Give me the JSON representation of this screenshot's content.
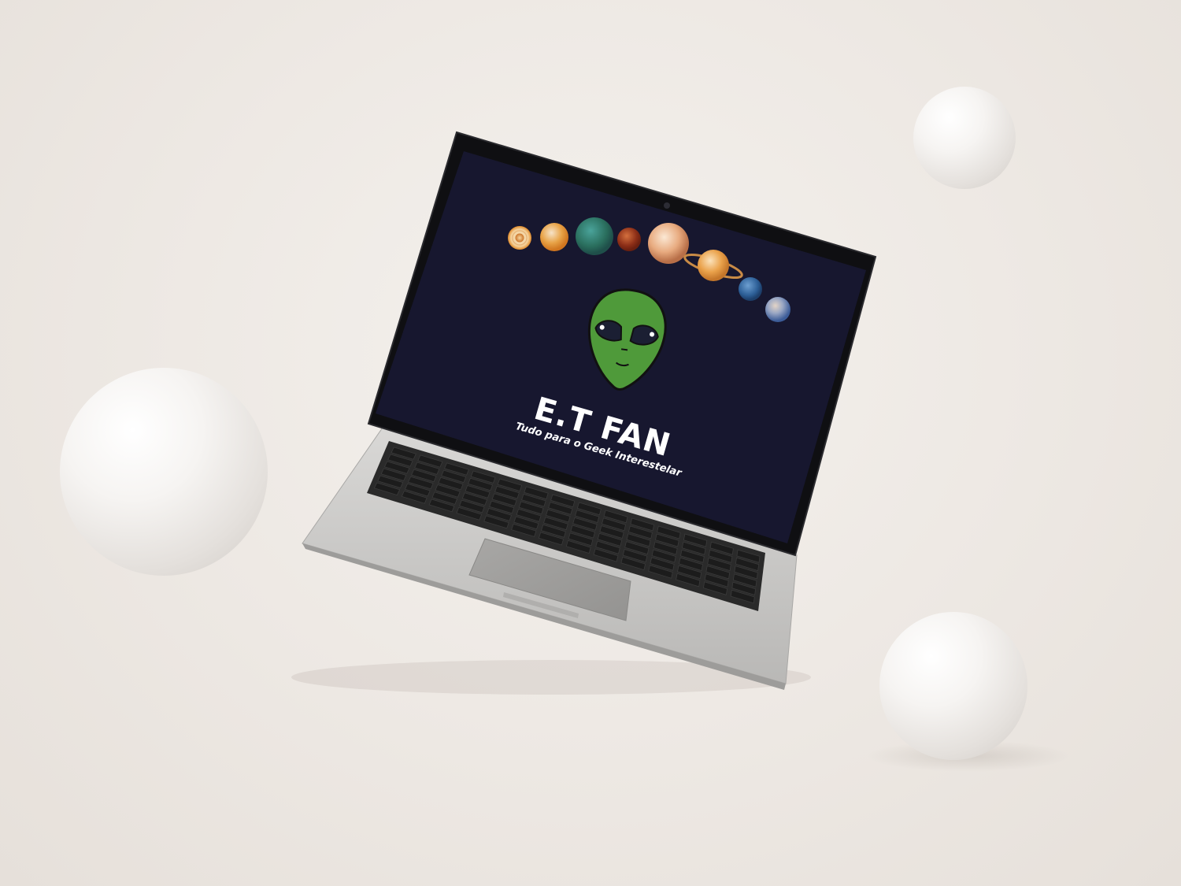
{
  "screen": {
    "brand_title": "E.T FAN",
    "tagline": "Tudo para o Geek Interestelar",
    "background_color": "#17172f",
    "alien_color": "#4f9a3a",
    "planets": [
      {
        "name": "sun-planet-icon",
        "color": "#e6892b"
      },
      {
        "name": "mercury-planet-icon",
        "color": "#e89a3a"
      },
      {
        "name": "earth-planet-icon",
        "color": "#2f7d6a"
      },
      {
        "name": "mars-planet-icon",
        "color": "#9e3a1f"
      },
      {
        "name": "jupiter-planet-icon",
        "color": "#e8b48a"
      },
      {
        "name": "saturn-planet-icon",
        "color": "#e9a146"
      },
      {
        "name": "uranus-planet-icon",
        "color": "#3a6fa6"
      },
      {
        "name": "neptune-planet-icon",
        "color": "#8ba0c4"
      }
    ]
  },
  "colors": {
    "backdrop": "#efebe7",
    "laptop_body": "#c9c8c6",
    "keyboard_keys": "#1c1c1c",
    "sphere": "#f3f1ef"
  }
}
